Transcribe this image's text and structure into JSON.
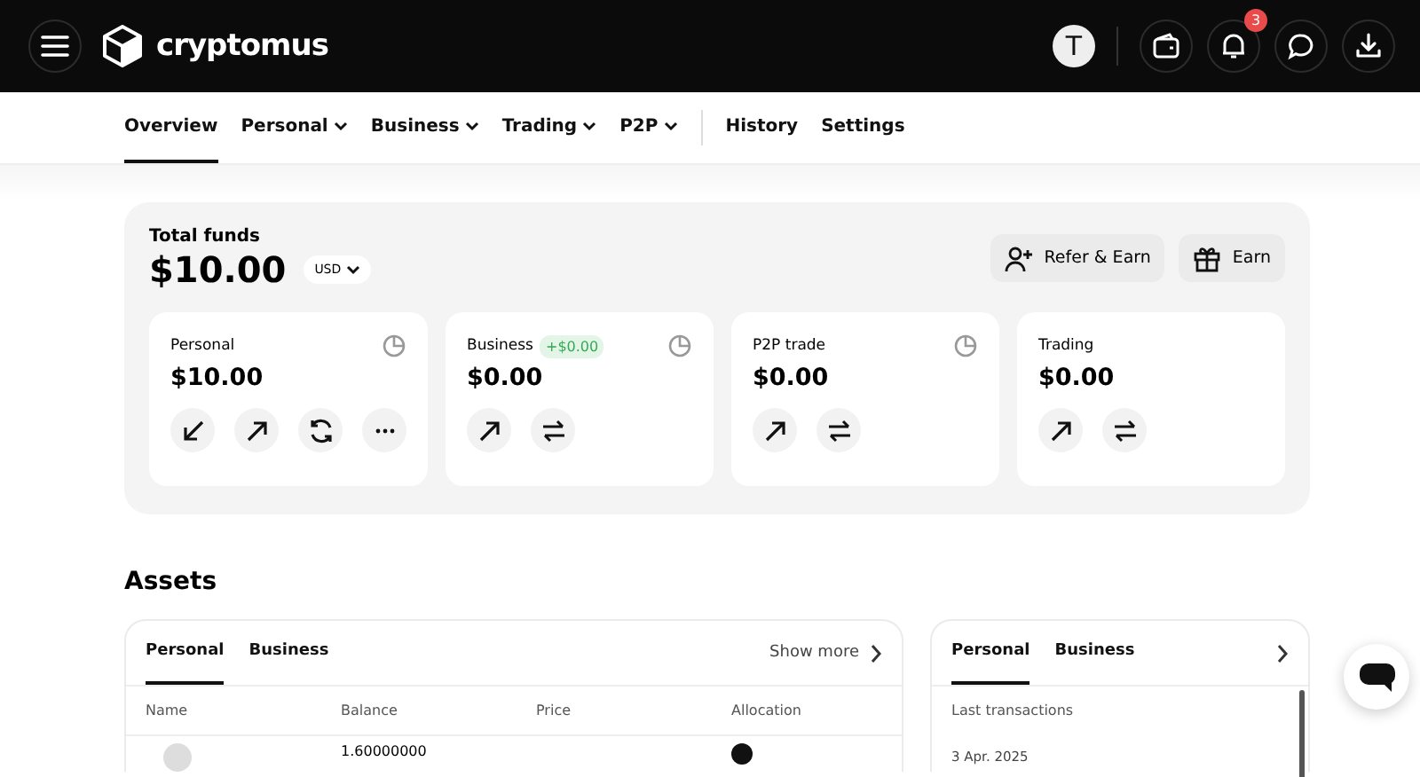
{
  "header": {
    "logo": "cryptomus",
    "avatar": "T",
    "notification_count": "3"
  },
  "nav": [
    {
      "label": "Overview",
      "selected": true,
      "dropdown": false
    },
    {
      "label": "Personal",
      "selected": false,
      "dropdown": true
    },
    {
      "label": "Business",
      "selected": false,
      "dropdown": true
    },
    {
      "label": "Trading",
      "selected": false,
      "dropdown": true
    },
    {
      "label": "P2P",
      "selected": false,
      "dropdown": true
    },
    {
      "label": "History",
      "selected": false,
      "dropdown": false,
      "separated": true
    },
    {
      "label": "Settings",
      "selected": false,
      "dropdown": false
    }
  ],
  "funds": {
    "title": "Total funds",
    "amount": "$10.00",
    "currency": "USD",
    "buttons": [
      {
        "label": "Refer & Earn",
        "kind": "refer"
      },
      {
        "label": "Earn",
        "kind": "gift"
      }
    ],
    "wallets": [
      {
        "name": "Personal",
        "amount": "$10.00",
        "chart_icon": true,
        "actions": [
          {
            "kind": "receive"
          },
          {
            "kind": "send"
          },
          {
            "kind": "exchange"
          },
          {
            "kind": "more"
          }
        ]
      },
      {
        "name": "Business",
        "badge": "+$0.00",
        "amount": "$0.00",
        "chart_icon": true,
        "actions": [
          {
            "kind": "send"
          },
          {
            "kind": "transfer"
          }
        ]
      },
      {
        "name": "P2P trade",
        "amount": "$0.00",
        "chart_icon": true,
        "actions": [
          {
            "kind": "send"
          },
          {
            "kind": "transfer"
          }
        ]
      },
      {
        "name": "Trading",
        "amount": "$0.00",
        "chart_icon": false,
        "actions": [
          {
            "kind": "send"
          },
          {
            "kind": "transfer"
          }
        ]
      }
    ]
  },
  "assets": {
    "title": "Assets",
    "tabs": [
      {
        "label": "Personal",
        "selected": true
      },
      {
        "label": "Business",
        "selected": false
      }
    ],
    "show_more": "Show more",
    "columns": [
      "Name",
      "Balance",
      "Price",
      "Allocation"
    ],
    "rows": [
      {
        "balance": "1.60000000"
      }
    ]
  },
  "transactions": {
    "tabs": [
      {
        "label": "Personal",
        "selected": true
      },
      {
        "label": "Business",
        "selected": false
      }
    ],
    "subtitle": "Last transactions",
    "dates": [
      "3 Apr. 2025"
    ]
  }
}
